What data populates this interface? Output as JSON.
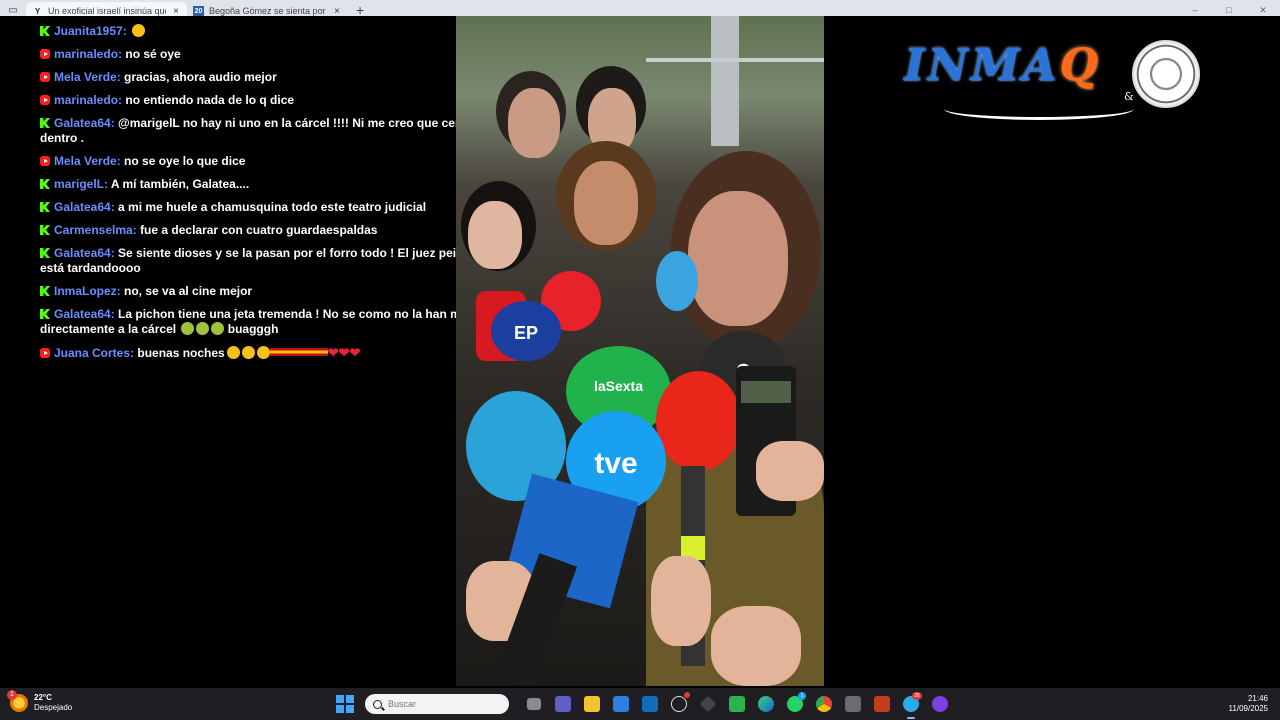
{
  "browser": {
    "tabs": [
      {
        "title": "Un exoficial israelí insinúa que Sá",
        "favicon": "Y",
        "active": true
      },
      {
        "title": "Begoña Gómez se sienta por cua",
        "favicon": "20",
        "active": false
      }
    ],
    "new_tab_label": "+",
    "close_glyph": "×",
    "window_controls": [
      "–",
      "□",
      "✕"
    ]
  },
  "chat": {
    "messages": [
      {
        "platform": "kick",
        "user": "Juanita1957:",
        "text": "",
        "emojis": [
          "face"
        ]
      },
      {
        "platform": "youtube",
        "user": "marinaledo:",
        "text": "no sé oye"
      },
      {
        "platform": "youtube",
        "user": "Mela Verde:",
        "text": "gracias, ahora audio mejor"
      },
      {
        "platform": "youtube",
        "user": "marinaledo:",
        "text": "no entiendo nada de lo q dice"
      },
      {
        "platform": "kick",
        "user": "Galatea64:",
        "text": "@marigelL no hay ni uno en la cárcel !!!! Ni me creo que cerdan esté dentro ."
      },
      {
        "platform": "youtube",
        "user": "Mela Verde:",
        "text": "no se oye lo que dice"
      },
      {
        "platform": "kick",
        "user": "marigelL:",
        "text": "A mí también, Galatea...."
      },
      {
        "platform": "kick",
        "user": "Galatea64:",
        "text": "a mi me huele a chamusquina todo este teatro judicial"
      },
      {
        "platform": "kick",
        "user": "Carmenselma:",
        "text": "fue a declarar con cuatro guardaespaldas"
      },
      {
        "platform": "kick",
        "user": "Galatea64:",
        "text": "Se siente dioses y se la pasan por el forro todo ! El juez peinado ya está tardandoooo"
      },
      {
        "platform": "kick",
        "user": "InmaLopez:",
        "text": "no, se va al cine mejor"
      },
      {
        "platform": "kick",
        "user": "Galatea64:",
        "text": "La pichon tiene una jeta tremenda ! No se como no la han metido directamente a la cárcel",
        "suffix": "buagggh",
        "emojis": [
          "sick",
          "sick",
          "sick"
        ]
      },
      {
        "platform": "youtube",
        "user": "Juana Cortes:",
        "text": "buenas noches",
        "emojis": [
          "cat",
          "cat",
          "cat"
        ],
        "flag": true,
        "hearts": "❤❤❤"
      }
    ]
  },
  "video": {
    "mic_labels": [
      "tve",
      "laSexta",
      "3",
      "EP",
      "Q"
    ]
  },
  "logo": {
    "text_main": "INMA",
    "text_q": "Q",
    "ampersand": "&"
  },
  "taskbar": {
    "weather": {
      "temp": "22°C",
      "desc": "Despejado",
      "badge": "1"
    },
    "search_placeholder": "Buscar",
    "icons": [
      "task-view-icon",
      "teams-icon",
      "file-explorer-icon",
      "store-icon",
      "outlook-icon",
      "chatgpt-icon",
      "app-icon",
      "camtasia-icon",
      "edge-icon",
      "whatsapp-icon",
      "chrome-icon",
      "vpn-icon",
      "powerpoint-icon",
      "telegram-icon",
      "obs-icon"
    ],
    "telegram_badge": "26",
    "whatsapp_badge": "1",
    "time": "21:46",
    "date": "11/09/2025"
  },
  "colors": {
    "kick": "#53fc18",
    "youtube": "#ff1f1f",
    "username": "#6b8cff",
    "taskbar": "#1f1f23"
  }
}
